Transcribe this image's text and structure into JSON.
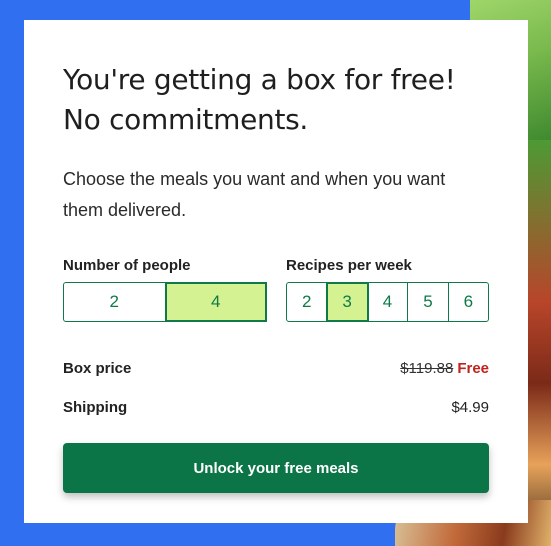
{
  "card": {
    "headline": "You're getting a box for free! No commitments.",
    "subtext": "Choose the meals you want and when you want them delivered."
  },
  "people": {
    "label": "Number of people",
    "options": [
      "2",
      "4"
    ],
    "selected": "4"
  },
  "recipes": {
    "label": "Recipes per week",
    "options": [
      "2",
      "3",
      "4",
      "5",
      "6"
    ],
    "selected": "3"
  },
  "pricing": {
    "box_label": "Box price",
    "box_original": "$119.88",
    "box_free": "Free",
    "shipping_label": "Shipping",
    "shipping_value": "$4.99"
  },
  "cta": {
    "label": "Unlock your free meals"
  },
  "colors": {
    "accent_green": "#0b7547",
    "selected_bg": "#d4f291",
    "free_red": "#c0221c",
    "background_blue": "#2f6ff0"
  }
}
